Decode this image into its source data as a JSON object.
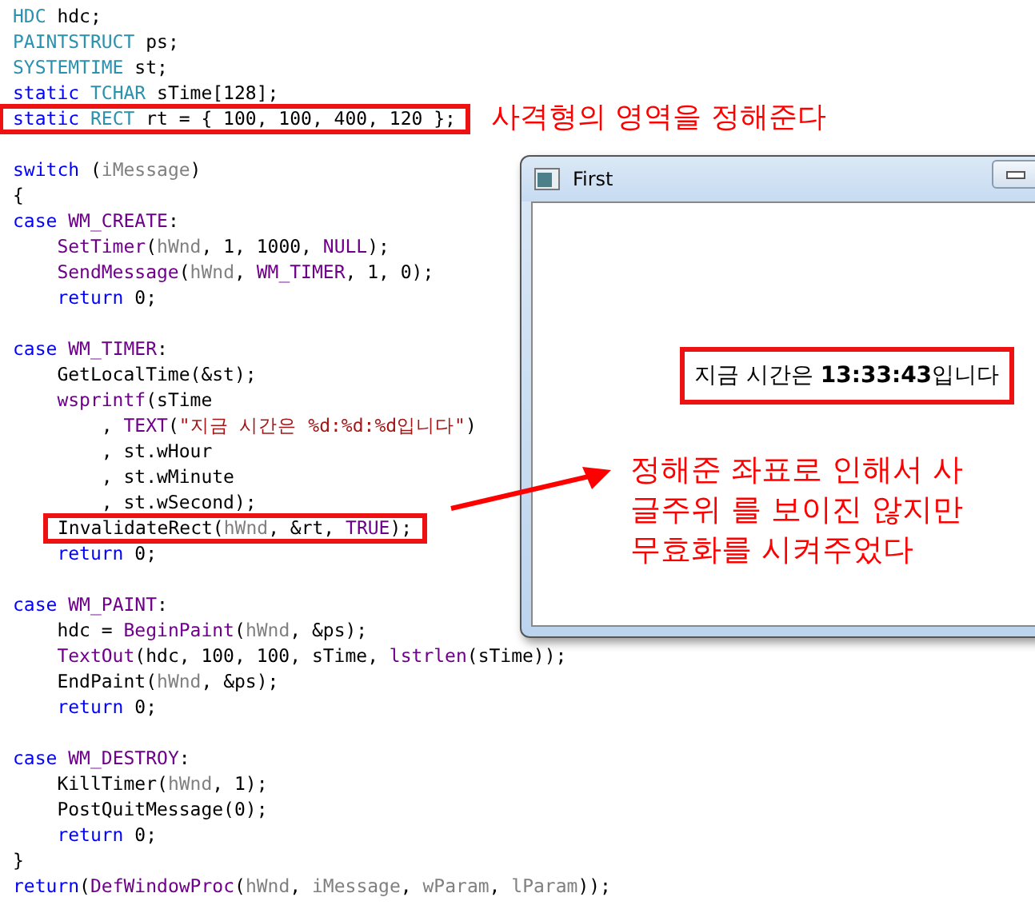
{
  "code_lines": [
    {
      "kind": "code",
      "tokens": [
        {
          "text": "HDC",
          "kind": "type"
        },
        {
          "text": " hdc;",
          "kind": "plain"
        }
      ]
    },
    {
      "kind": "code",
      "tokens": [
        {
          "text": "PAINTSTRUCT",
          "kind": "type"
        },
        {
          "text": " ps;",
          "kind": "plain"
        }
      ]
    },
    {
      "kind": "code",
      "tokens": [
        {
          "text": "SYSTEMTIME",
          "kind": "type"
        },
        {
          "text": " st;",
          "kind": "plain"
        }
      ]
    },
    {
      "kind": "code",
      "tokens": [
        {
          "text": "static",
          "kind": "keyword"
        },
        {
          "text": " TCHAR",
          "kind": "type"
        },
        {
          "text": " sTime[128];",
          "kind": "plain"
        }
      ]
    },
    {
      "kind": "boxed",
      "tokens": [
        {
          "text": "static",
          "kind": "keyword"
        },
        {
          "text": " RECT",
          "kind": "type"
        },
        {
          "text": " rt = { 100, 100, 400, 120 };",
          "kind": "plain"
        }
      ]
    },
    {
      "kind": "blank"
    },
    {
      "kind": "code",
      "tokens": [
        {
          "text": "switch",
          "kind": "keyword"
        },
        {
          "text": " (",
          "kind": "plain"
        },
        {
          "text": "iMessage",
          "kind": "param"
        },
        {
          "text": ")",
          "kind": "plain"
        }
      ]
    },
    {
      "kind": "code",
      "tokens": [
        {
          "text": "{",
          "kind": "plain"
        }
      ]
    },
    {
      "kind": "code",
      "tokens": [
        {
          "text": "case",
          "kind": "keyword"
        },
        {
          "text": " WM_CREATE",
          "kind": "macro"
        },
        {
          "text": ":",
          "kind": "plain"
        }
      ]
    },
    {
      "kind": "code",
      "tokens": [
        {
          "text": "    SetTimer",
          "kind": "macro"
        },
        {
          "text": "(",
          "kind": "plain"
        },
        {
          "text": "hWnd",
          "kind": "param"
        },
        {
          "text": ", 1, 1000, ",
          "kind": "plain"
        },
        {
          "text": "NULL",
          "kind": "macro"
        },
        {
          "text": ");",
          "kind": "plain"
        }
      ]
    },
    {
      "kind": "code",
      "tokens": [
        {
          "text": "    SendMessage",
          "kind": "macro"
        },
        {
          "text": "(",
          "kind": "plain"
        },
        {
          "text": "hWnd",
          "kind": "param"
        },
        {
          "text": ", ",
          "kind": "plain"
        },
        {
          "text": "WM_TIMER",
          "kind": "macro"
        },
        {
          "text": ", 1, 0);",
          "kind": "plain"
        }
      ]
    },
    {
      "kind": "code",
      "tokens": [
        {
          "text": "    return",
          "kind": "keyword"
        },
        {
          "text": " 0;",
          "kind": "plain"
        }
      ]
    },
    {
      "kind": "blank"
    },
    {
      "kind": "code",
      "tokens": [
        {
          "text": "case",
          "kind": "keyword"
        },
        {
          "text": " WM_TIMER",
          "kind": "macro"
        },
        {
          "text": ":",
          "kind": "plain"
        }
      ]
    },
    {
      "kind": "code",
      "tokens": [
        {
          "text": "    GetLocalTime(&st);",
          "kind": "plain"
        }
      ]
    },
    {
      "kind": "code",
      "tokens": [
        {
          "text": "    wsprintf",
          "kind": "macro"
        },
        {
          "text": "(sTime",
          "kind": "plain"
        }
      ]
    },
    {
      "kind": "code",
      "tokens": [
        {
          "text": "        , ",
          "kind": "plain"
        },
        {
          "text": "TEXT",
          "kind": "macro"
        },
        {
          "text": "(",
          "kind": "plain"
        },
        {
          "text": "\"지금 시간은 %d:%d:%d입니다\"",
          "kind": "string"
        },
        {
          "text": ")",
          "kind": "plain"
        }
      ]
    },
    {
      "kind": "code",
      "tokens": [
        {
          "text": "        , st.wHour",
          "kind": "plain"
        }
      ]
    },
    {
      "kind": "code",
      "tokens": [
        {
          "text": "        , st.wMinute",
          "kind": "plain"
        }
      ]
    },
    {
      "kind": "code",
      "tokens": [
        {
          "text": "        , st.wSecond);",
          "kind": "plain"
        }
      ]
    },
    {
      "kind": "boxed",
      "tokens": [
        {
          "text": "InvalidateRect(",
          "kind": "plain"
        },
        {
          "text": "hWnd",
          "kind": "param"
        },
        {
          "text": ", &rt, ",
          "kind": "plain"
        },
        {
          "text": "TRUE",
          "kind": "macro"
        },
        {
          "text": ");",
          "kind": "plain"
        }
      ]
    },
    {
      "kind": "code",
      "tokens": [
        {
          "text": "    return",
          "kind": "keyword"
        },
        {
          "text": " 0;",
          "kind": "plain"
        }
      ]
    },
    {
      "kind": "blank"
    },
    {
      "kind": "code",
      "tokens": [
        {
          "text": "case",
          "kind": "keyword"
        },
        {
          "text": " WM_PAINT",
          "kind": "macro"
        },
        {
          "text": ":",
          "kind": "plain"
        }
      ]
    },
    {
      "kind": "code",
      "tokens": [
        {
          "text": "    hdc = ",
          "kind": "plain"
        },
        {
          "text": "BeginPaint",
          "kind": "macro"
        },
        {
          "text": "(",
          "kind": "plain"
        },
        {
          "text": "hWnd",
          "kind": "param"
        },
        {
          "text": ", &ps);",
          "kind": "plain"
        }
      ]
    },
    {
      "kind": "code",
      "tokens": [
        {
          "text": "    TextOut",
          "kind": "macro"
        },
        {
          "text": "(hdc, 100, 100, sTime, ",
          "kind": "plain"
        },
        {
          "text": "lstrlen",
          "kind": "macro"
        },
        {
          "text": "(sTime));",
          "kind": "plain"
        }
      ]
    },
    {
      "kind": "code",
      "tokens": [
        {
          "text": "    EndPaint(",
          "kind": "plain"
        },
        {
          "text": "hWnd",
          "kind": "param"
        },
        {
          "text": ", &ps);",
          "kind": "plain"
        }
      ]
    },
    {
      "kind": "code",
      "tokens": [
        {
          "text": "    return",
          "kind": "keyword"
        },
        {
          "text": " 0;",
          "kind": "plain"
        }
      ]
    },
    {
      "kind": "blank"
    },
    {
      "kind": "code",
      "tokens": [
        {
          "text": "case",
          "kind": "keyword"
        },
        {
          "text": " WM_DESTROY",
          "kind": "macro"
        },
        {
          "text": ":",
          "kind": "plain"
        }
      ]
    },
    {
      "kind": "code",
      "tokens": [
        {
          "text": "    KillTimer(",
          "kind": "plain"
        },
        {
          "text": "hWnd",
          "kind": "param"
        },
        {
          "text": ", 1);",
          "kind": "plain"
        }
      ]
    },
    {
      "kind": "code",
      "tokens": [
        {
          "text": "    PostQuitMessage(0);",
          "kind": "plain"
        }
      ]
    },
    {
      "kind": "code",
      "tokens": [
        {
          "text": "    return",
          "kind": "keyword"
        },
        {
          "text": " 0;",
          "kind": "plain"
        }
      ]
    },
    {
      "kind": "code",
      "tokens": [
        {
          "text": "}",
          "kind": "plain"
        }
      ]
    },
    {
      "kind": "code",
      "tokens": [
        {
          "text": "return",
          "kind": "keyword"
        },
        {
          "text": "(",
          "kind": "plain"
        },
        {
          "text": "DefWindowProc",
          "kind": "macro"
        },
        {
          "text": "(",
          "kind": "plain"
        },
        {
          "text": "hWnd",
          "kind": "param"
        },
        {
          "text": ", ",
          "kind": "plain"
        },
        {
          "text": "iMessage",
          "kind": "param"
        },
        {
          "text": ", ",
          "kind": "plain"
        },
        {
          "text": "wParam",
          "kind": "param"
        },
        {
          "text": ", ",
          "kind": "plain"
        },
        {
          "text": "lParam",
          "kind": "param"
        },
        {
          "text": "));",
          "kind": "plain"
        }
      ]
    }
  ],
  "annotation_top": "사격형의 영역을 정해준다",
  "app_window": {
    "title": "First",
    "output_text": "지금 시간은 **13:33:43**입니다"
  },
  "annotation_bottom": [
    "정해준 좌표로 인해서 사",
    "글주위 를 보이진 않지만",
    "무효화를 시켜주었다"
  ]
}
